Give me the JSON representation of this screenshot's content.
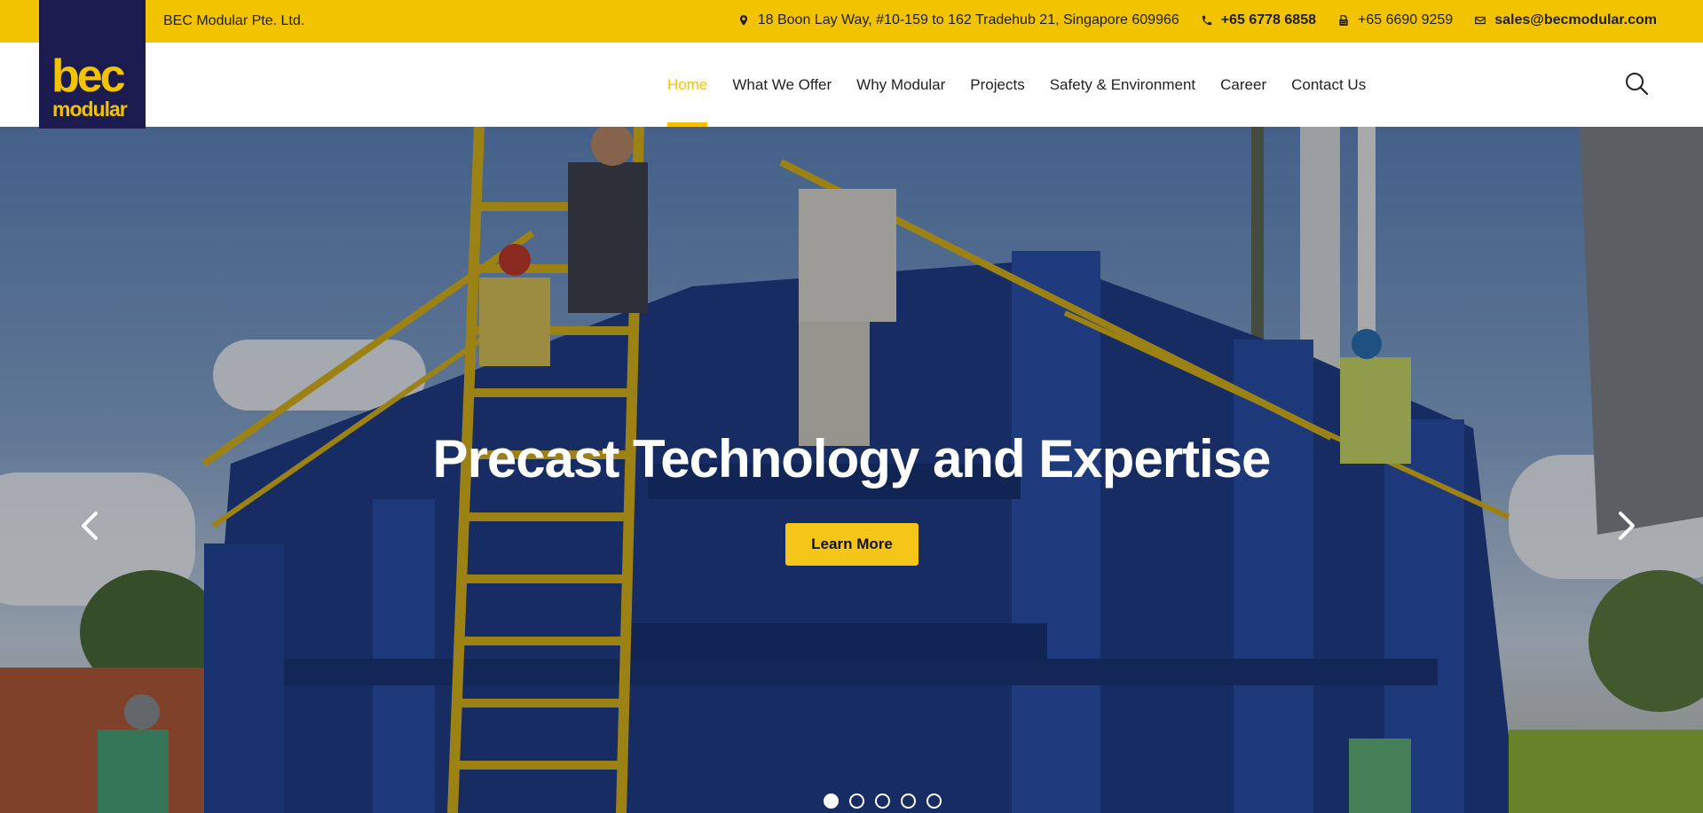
{
  "topbar": {
    "company": "BEC Modular Pte. Ltd.",
    "address": "18 Boon Lay Way, #10-159 to 162 Tradehub 21, Singapore 609966",
    "phone": "+65 6778 6858",
    "fax": "+65 6690 9259",
    "email": "sales@becmodular.com"
  },
  "logo": {
    "line1": "bec",
    "line2": "modular"
  },
  "nav": [
    {
      "label": "Home",
      "active": true
    },
    {
      "label": "What We Offer"
    },
    {
      "label": "Why Modular"
    },
    {
      "label": "Projects"
    },
    {
      "label": "Safety & Environment"
    },
    {
      "label": "Career"
    },
    {
      "label": "Contact Us"
    }
  ],
  "hero": {
    "title": "Precast Technology and Expertise",
    "cta": "Learn More",
    "slides_total": 5,
    "active_slide": 1
  },
  "icons": {
    "address": "map-pin-icon",
    "phone": "phone-icon",
    "fax": "fax-icon",
    "email": "envelope-icon",
    "search": "search-icon",
    "prev": "chevron-left-icon",
    "next": "chevron-right-icon"
  },
  "colors": {
    "brand_yellow": "#f2c300",
    "brand_navy": "#1c1b4f",
    "cta_yellow": "#f5c518"
  }
}
